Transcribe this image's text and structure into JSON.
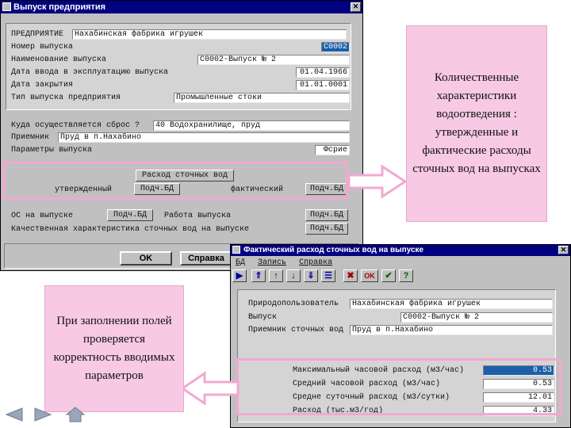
{
  "win1": {
    "title": "Выпуск предприятия",
    "fields": {
      "enterprise_label": "ПРЕДПРИЯТИЕ",
      "enterprise_value": "Нахабинская фабрика игрушек",
      "number_label": "Номер выпуска",
      "number_value": "C0002",
      "name_label": "Наименование выпуска",
      "name_value": "C0002-Выпуск № 2",
      "commission_label": "Дата ввода в эксплуатацию выпуска",
      "commission_value": "01.04.1966",
      "closed_label": "Дата закрытия",
      "closed_value": "01.01.0001",
      "type_label": "Тип выпуска предприятия",
      "type_value": "Промышленные стоки",
      "discharge_label": "Куда осуществляется сброс ?",
      "discharge_value": "40 Водохранилище, пруд",
      "receiver_label": "Приемник",
      "receiver_value": "Пруд в п.Нахабино",
      "params_label": "Параметры выпуска",
      "params_value": "Фсрие"
    },
    "flow": {
      "header": "Расход сточных вод",
      "approved_label": "утвержденный",
      "approved_btn": "Подч.БД",
      "actual_label": "фактический",
      "actual_btn": "Подч.БД"
    },
    "os_label": "ОС на выпуске",
    "os_btn": "Подч.БД",
    "work_label": "Работа выпуска",
    "work_btn": "Подч.БД",
    "quality_label": "Качественная характеристика сточных вод на выпуске",
    "quality_btn": "Подч.БД",
    "ok_label": "OK",
    "help_label": "Справка"
  },
  "win2": {
    "title": "Фактический расход сточных вод на выпуске",
    "menu": [
      "БД",
      "Запись",
      "Справка"
    ],
    "toolbar": [
      "next-icon",
      "first-icon",
      "up-icon",
      "down-icon",
      "last-icon",
      "filter-icon",
      "delete-icon",
      "ok-icon",
      "check-icon",
      "help-icon"
    ],
    "toolbar_ok": "OK",
    "toolbar_help": "?",
    "user_label": "Природопользователь",
    "user_value": "Нахабинская фабрика игрушек",
    "outlet_label": "Выпуск",
    "outlet_value": "C0002-Выпуск № 2",
    "receiver_label": "Приемник сточных вод",
    "receiver_value": "Пруд в п.Нахабино",
    "rows": [
      {
        "label": "Максимальный часовой расход (м3/час)",
        "value": "0.53"
      },
      {
        "label": "Средний часовой расход (м3/час)",
        "value": "0.53"
      },
      {
        "label": "Средне суточный расход (м3/сутки)",
        "value": "12.01"
      },
      {
        "label": "Расход (тыс.м3/год)",
        "value": "4.33"
      }
    ]
  },
  "callout_right": "Количественные характеристики водоотведения : утвержденные и фактические расходы сточных вод на выпусках",
  "callout_left": "При заполнении полей проверяется корректность вводимых параметров",
  "colors": {
    "title_bar": "#000080",
    "window_bg": "#c0c0c0",
    "callout_bg": "#f7c9e4",
    "highlight": "#f2a8d2",
    "selected_field": "#1c5fa8"
  }
}
